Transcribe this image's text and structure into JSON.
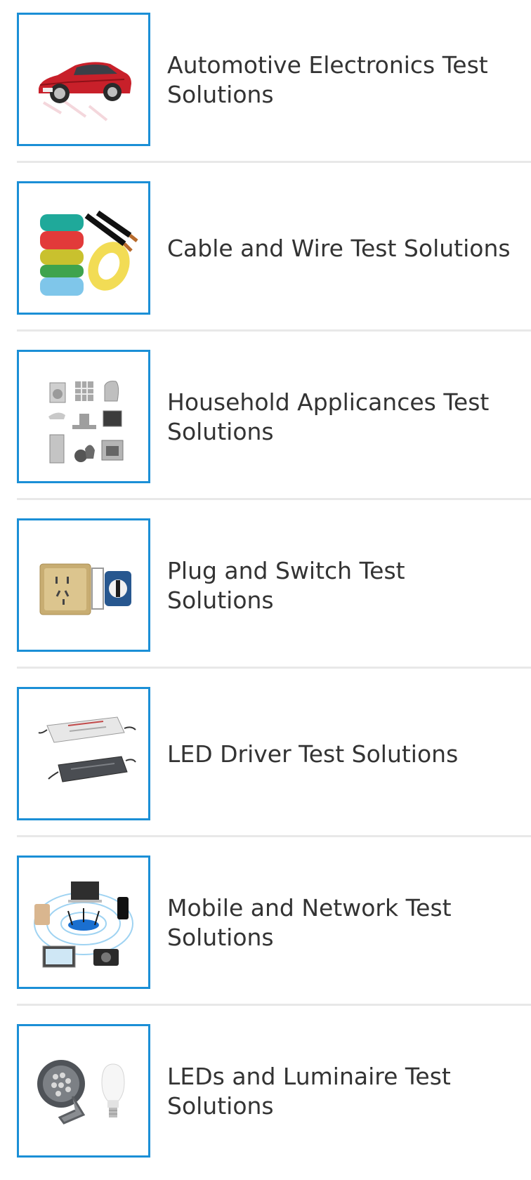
{
  "solutions": {
    "items": [
      {
        "label": "Automotive Electronics Test Solutions",
        "image_icon": "red-car-image"
      },
      {
        "label": "Cable and Wire Test Solutions",
        "image_icon": "cable-coils-image"
      },
      {
        "label": "Household Applicances Test Solutions",
        "image_icon": "home-appliances-image"
      },
      {
        "label": "Plug and Switch Test Solutions",
        "image_icon": "wall-socket-switch-image"
      },
      {
        "label": "LED Driver Test Solutions",
        "image_icon": "led-driver-modules-image"
      },
      {
        "label": "Mobile and Network Test Solutions",
        "image_icon": "network-devices-image"
      },
      {
        "label": "LEDs and Luminaire Test Solutions",
        "image_icon": "floodlight-bulb-image"
      }
    ]
  },
  "colors": {
    "thumb_border": "#1b8fd6",
    "divider": "#e8e8e8",
    "text": "#333333"
  }
}
